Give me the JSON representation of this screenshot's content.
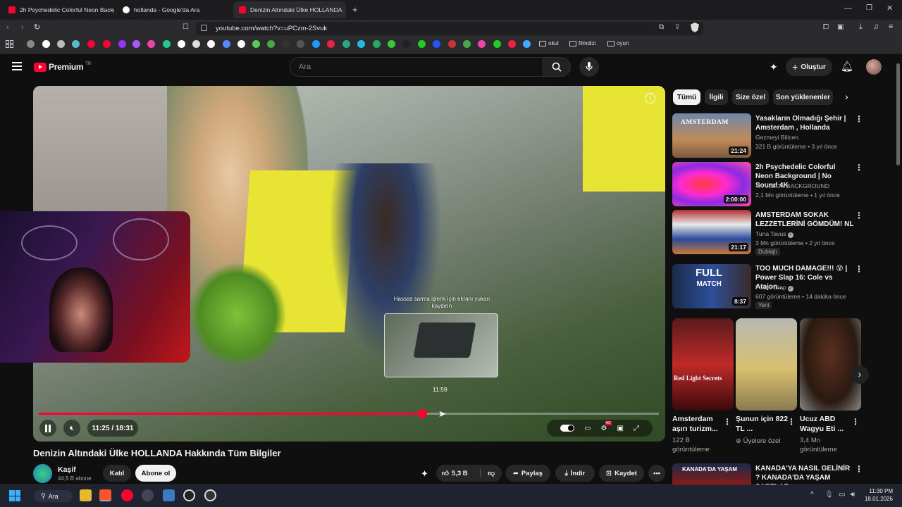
{
  "browser": {
    "tabs": [
      {
        "label": "2h Psychedelic Colorful Neon Backgr",
        "active": false
      },
      {
        "label": "hollanda - Google'da Ara",
        "active": false
      },
      {
        "label": "Denizin Altındaki Ülke HOLLANDA",
        "active": true
      }
    ],
    "url": "youtube.com/watch?v=uPCzm-2Svuk",
    "bookmark_folders": [
      "okul",
      "filmdizi",
      "oyun"
    ]
  },
  "header": {
    "logo_text": "Premium",
    "logo_sup": "TR",
    "search_placeholder": "Ara",
    "create_label": "Oluştur"
  },
  "player": {
    "scroll_hint": "Hassas sarma işlemi için ekranı yukarı kaydırın",
    "preview_time": "11:59",
    "time_display": "11:25 / 18:31",
    "progress_fraction": 0.618,
    "hd_badge": "HD"
  },
  "video": {
    "title": "Denizin Altındaki Ülke HOLLANDA Hakkında Tüm Bilgiler",
    "channel": "Kaşif",
    "subscribers": "44,5 B abone",
    "join_label": "Katıl",
    "subscribe_label": "Abone ol",
    "likes": "5,3 B",
    "share_label": "Paylaş",
    "download_label": "İndir",
    "save_label": "Kaydet"
  },
  "chips": [
    "Tümü",
    "İlgili",
    "Size özel",
    "Son yüklenenler"
  ],
  "sidebar_videos": [
    {
      "title": "Yasakların Olmadığı Şehir | Amsterdam , Hollanda",
      "channel": "Gezmeyi Bilicen",
      "meta": "321 B görüntüleme • 3 yıl önce",
      "duration": "21:24",
      "verified": false,
      "badge": ""
    },
    {
      "title": "2h Psychedelic Colorful Neon Background | No Sound 4K",
      "channel": "4K VISION BACKGROUND",
      "meta": "2,1 Mn görüntüleme • 1 yıl önce",
      "duration": "2:00:00",
      "verified": false,
      "badge": ""
    },
    {
      "title": "AMSTERDAM SOKAK LEZZETLERİNİ GÖMDÜM! NL",
      "channel": "Tuna Tavus",
      "meta": "3 Mn görüntüleme • 2 yıl önce",
      "duration": "21:17",
      "verified": true,
      "badge": "Dublajlı"
    },
    {
      "title": "TOO MUCH DAMAGE!!! 😵 | Power Slap 16: Cole vs Atajon...",
      "channel": "Power Slap",
      "meta": "607 görüntüleme • 14 dakika önce",
      "duration": "8:37",
      "verified": true,
      "badge": "Yeni"
    }
  ],
  "thumb_text": {
    "amsterdam": "AMSTERDAM",
    "full": "FULL",
    "match": "MATCH",
    "red_light": "Red Light Secrets"
  },
  "shorts": [
    {
      "title": "Amsterdam aşırı turizm...",
      "meta": "122 B görüntüleme"
    },
    {
      "title": "Şunun için 822 TL ...",
      "meta": "Üyelere özel"
    },
    {
      "title": "Ucuz ABD Wagyu Eti ...",
      "meta": "3,4 Mn görüntüleme"
    }
  ],
  "bottom_video": {
    "title": "KANADA'YA NASIL GELİNİR ? KANADA'DA YAŞAM ŞARTLAR...",
    "thumb_text": "KANADA'DA YAŞAM"
  },
  "taskbar": {
    "search_label": "Ara",
    "time": "11:30 PM",
    "date": "18.01.2026"
  }
}
